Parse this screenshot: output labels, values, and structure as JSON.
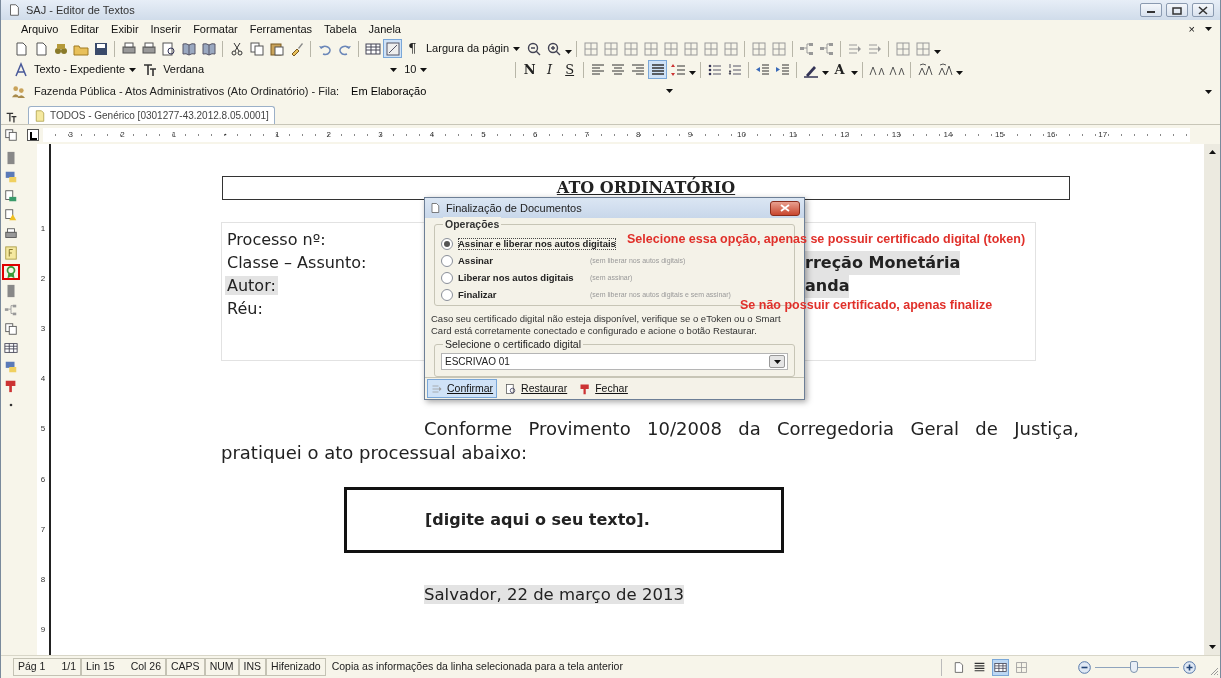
{
  "window": {
    "title": "SAJ - Editor de Textos"
  },
  "menu": [
    {
      "label": "Arquivo"
    },
    {
      "label": "Editar"
    },
    {
      "label": "Exibir"
    },
    {
      "label": "Inserir"
    },
    {
      "label": "Formatar"
    },
    {
      "label": "Ferramentas"
    },
    {
      "label": "Tabela"
    },
    {
      "label": "Janela"
    }
  ],
  "menu_close": "×",
  "toolbar_1": [
    {
      "kind": "button",
      "pressed": false
    },
    {
      "kind": "button",
      "pressed": false
    },
    {
      "kind": "button",
      "pressed": false
    },
    {
      "kind": "button",
      "pressed": false
    },
    {
      "kind": "button",
      "pressed": false
    },
    {
      "kind": "separator"
    },
    {
      "kind": "button",
      "pressed": false
    },
    {
      "kind": "button",
      "pressed": false
    },
    {
      "kind": "button",
      "pressed": false
    },
    {
      "kind": "button",
      "pressed": false
    },
    {
      "kind": "button",
      "pressed": false
    },
    {
      "kind": "separator"
    },
    {
      "kind": "button",
      "pressed": false
    },
    {
      "kind": "button",
      "pressed": false
    },
    {
      "kind": "button",
      "pressed": false
    },
    {
      "kind": "button",
      "pressed": false
    },
    {
      "kind": "separator"
    },
    {
      "kind": "button",
      "pressed": false
    },
    {
      "kind": "button",
      "pressed": false
    },
    {
      "kind": "separator"
    },
    {
      "kind": "button",
      "pressed": false
    },
    {
      "kind": "button",
      "pressed": true
    },
    {
      "kind": "text",
      "text": "¶",
      "pressed": false
    },
    {
      "kind": "dropdown",
      "value": "Largura da págin"
    },
    {
      "kind": "button",
      "pressed": false
    },
    {
      "kind": "button",
      "pressed": false
    },
    {
      "kind": "chevron"
    },
    {
      "kind": "separator"
    },
    {
      "kind": "button",
      "pressed": false
    },
    {
      "kind": "button",
      "pressed": false
    },
    {
      "kind": "button",
      "pressed": false
    },
    {
      "kind": "button",
      "pressed": false
    },
    {
      "kind": "button",
      "pressed": false
    },
    {
      "kind": "button",
      "pressed": false
    },
    {
      "kind": "button",
      "pressed": false
    },
    {
      "kind": "button",
      "pressed": false
    },
    {
      "kind": "separator"
    },
    {
      "kind": "button",
      "pressed": false
    },
    {
      "kind": "button",
      "pressed": false
    },
    {
      "kind": "separator"
    },
    {
      "kind": "button",
      "pressed": false
    },
    {
      "kind": "button",
      "pressed": false
    },
    {
      "kind": "separator"
    },
    {
      "kind": "button",
      "pressed": false
    },
    {
      "kind": "button",
      "pressed": false
    },
    {
      "kind": "separator"
    },
    {
      "kind": "button",
      "pressed": false
    },
    {
      "kind": "button",
      "pressed": false
    },
    {
      "kind": "chevron"
    }
  ],
  "toolbar_2": [
    {
      "kind": "button",
      "pressed": false
    },
    {
      "kind": "dropdown",
      "value": "Texto - Expediente"
    },
    {
      "kind": "button",
      "pressed": false
    },
    {
      "kind": "dropdown",
      "value": "Verdana"
    },
    {
      "kind": "dropdown",
      "value": "10"
    },
    {
      "kind": "separator"
    },
    {
      "kind": "text",
      "text": "N",
      "pressed": false
    },
    {
      "kind": "text",
      "text": "I",
      "pressed": false
    },
    {
      "kind": "text",
      "text": "S",
      "pressed": false
    },
    {
      "kind": "separator"
    },
    {
      "kind": "button",
      "pressed": false
    },
    {
      "kind": "button",
      "pressed": false
    },
    {
      "kind": "button",
      "pressed": false
    },
    {
      "kind": "button",
      "pressed": true
    },
    {
      "kind": "button",
      "pressed": false
    },
    {
      "kind": "chevron"
    },
    {
      "kind": "separator"
    },
    {
      "kind": "button",
      "pressed": false
    },
    {
      "kind": "button",
      "pressed": false
    },
    {
      "kind": "separator"
    },
    {
      "kind": "button",
      "pressed": false
    },
    {
      "kind": "button",
      "pressed": false
    },
    {
      "kind": "separator"
    },
    {
      "kind": "button",
      "pressed": false
    },
    {
      "kind": "chevron"
    },
    {
      "kind": "text",
      "text": "A",
      "pressed": false
    },
    {
      "kind": "chevron"
    },
    {
      "kind": "separator"
    },
    {
      "kind": "button",
      "pressed": false
    },
    {
      "kind": "button",
      "pressed": false
    },
    {
      "kind": "separator"
    },
    {
      "kind": "button",
      "pressed": false
    },
    {
      "kind": "button",
      "pressed": false
    },
    {
      "kind": "chevron"
    }
  ],
  "queue_bar": {
    "label": "Fazenda Pública - Atos Administrativos (Ato Ordinatório) - Fila:",
    "value": "Em Elaboração"
  },
  "document_tab": {
    "label": "TODOS - Genérico [0301277-43.2012.8.05.0001]",
    "selected": true
  },
  "ruler": {
    "left_labels": [
      "3",
      "2",
      "1"
    ],
    "right_labels": [
      "1",
      "2",
      "3",
      "4",
      "5",
      "6",
      "7",
      "8",
      "9",
      "10",
      "11",
      "12",
      "13",
      "14",
      "15",
      "16",
      "17"
    ]
  },
  "vertical_ruler": {
    "labels": [
      "1",
      "2",
      "3",
      "4",
      "5",
      "6",
      "7",
      "8",
      "9"
    ]
  },
  "left_toolbar": [
    {
      "highlighted": false
    },
    {
      "highlighted": false
    },
    {
      "highlighted": false
    },
    {
      "highlighted": false
    },
    {
      "highlighted": false
    },
    {
      "highlighted": false
    },
    {
      "highlighted": true
    },
    {
      "highlighted": false
    },
    {
      "highlighted": false
    },
    {
      "highlighted": false
    },
    {
      "highlighted": false
    },
    {
      "highlighted": false
    },
    {
      "highlighted": false
    },
    {
      "highlighted": false
    }
  ],
  "document": {
    "heading": "ATO ORDINATÓRIO",
    "fields": [
      {
        "label": "Processo nº:"
      },
      {
        "label": "Classe – Assunto:",
        "value": "rreção Monetária"
      },
      {
        "label": "Autor:",
        "value": "anda",
        "highlighted": true
      },
      {
        "label": "Réu:"
      }
    ],
    "paragraph": "Conforme Provimento 10/2008 da Corregedoria Geral de Justiça, pratiquei o ato processual abaixo:",
    "text_box": "[digite aqui o seu texto].",
    "date_line": "Salvador, 22 de março de 2013"
  },
  "dialog": {
    "title": "Finalização de Documentos",
    "operations_title": "Operações",
    "options": [
      {
        "label": "Assinar e liberar nos autos digitais",
        "selected": true
      },
      {
        "label": "Assinar",
        "hint": "(sem liberar nos autos digitais)",
        "selected": false
      },
      {
        "label": "Liberar nos autos digitais",
        "hint": "(sem assinar)",
        "selected": false
      },
      {
        "label": "Finalizar",
        "hint": "(sem liberar nos autos digitais e sem assinar)",
        "selected": false
      }
    ],
    "info": "Caso seu certificado digital não esteja disponível, verifique se o eToken ou o Smart Card está corretamente conectado e configurado e acione o botão Restaurar.",
    "certificate_title": "Selecione o certificado digital",
    "certificate": "ESCRIVAO 01",
    "buttons": [
      {
        "label": "Confirmar",
        "selected": true
      },
      {
        "label": "Restaurar",
        "selected": false
      },
      {
        "label": "Fechar",
        "selected": false
      }
    ]
  },
  "annotations": [
    "Selecione essa opção, apenas se possuir certificado digital (token)",
    "Se não possuir certificado, apenas finalize"
  ],
  "status_bar": {
    "cells": [
      "Pág 1",
      "1/1",
      "Lin 15",
      "Col 26",
      "CAPS",
      "NUM",
      "INS",
      "Hifenizado"
    ],
    "message": "Copia as informações da linha selecionada para a tela anterior",
    "views": [
      {
        "selected": false
      },
      {
        "selected": false
      },
      {
        "selected": true
      },
      {
        "selected": false
      }
    ],
    "zoom": {
      "level": 0.46
    }
  }
}
